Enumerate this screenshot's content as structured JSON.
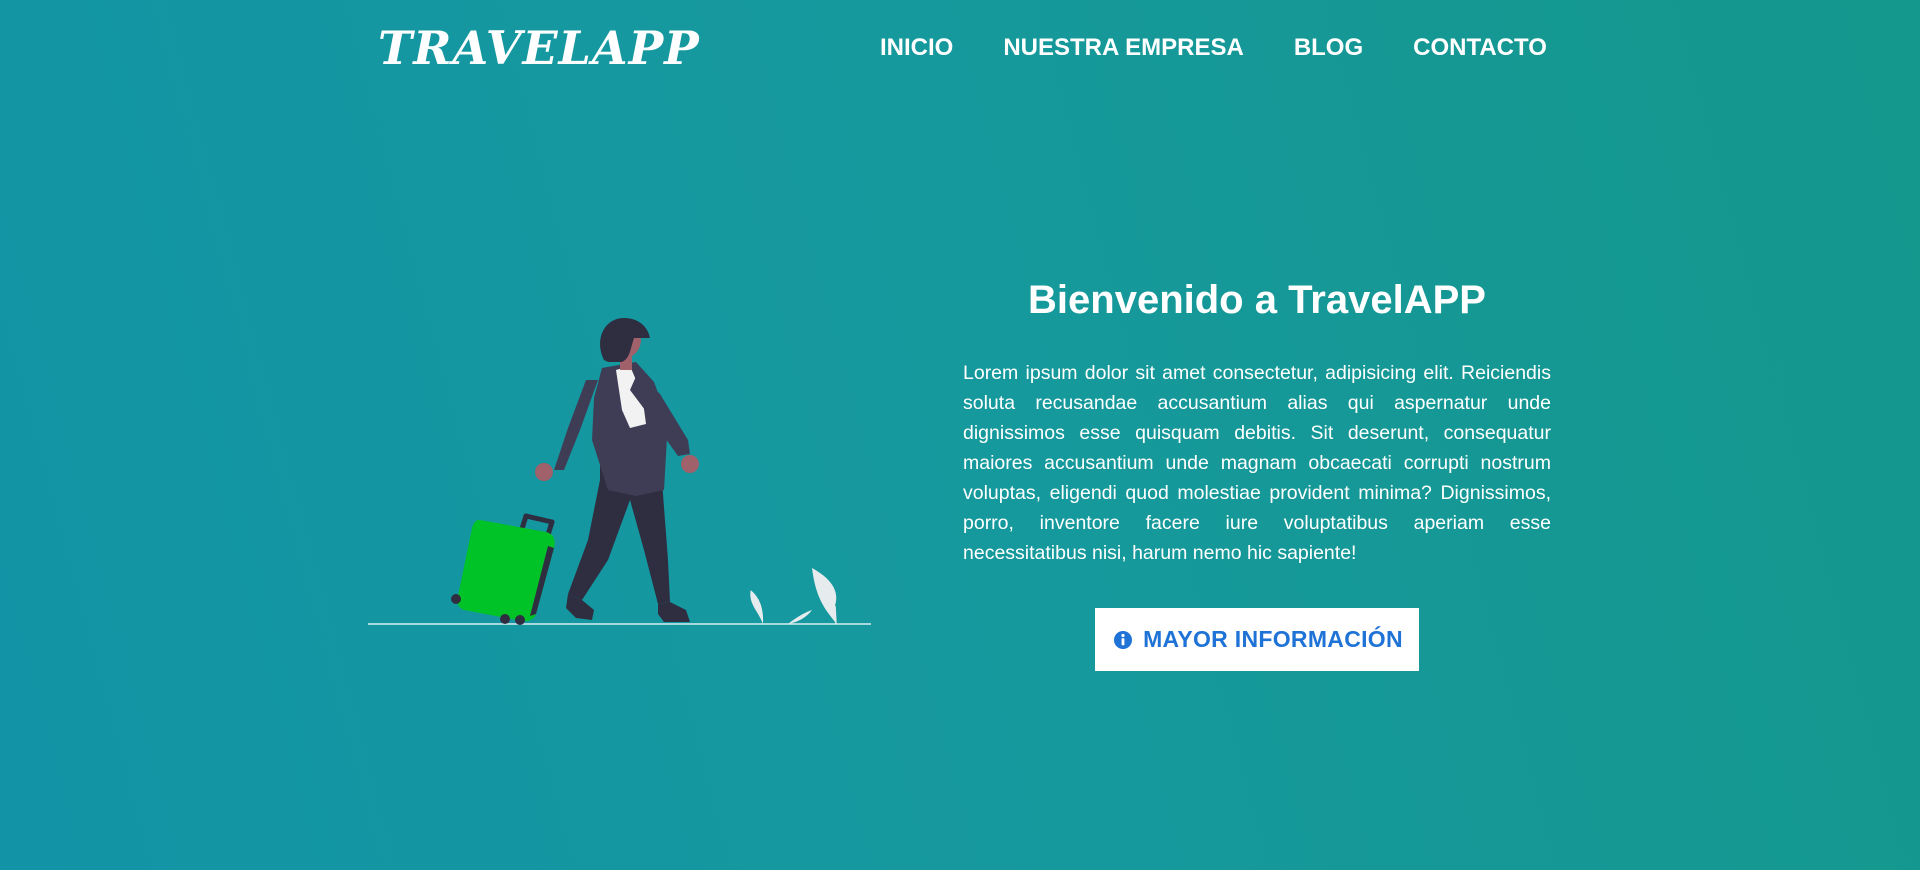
{
  "header": {
    "logo": "TRAVELAPP",
    "nav": [
      {
        "label": "INICIO"
      },
      {
        "label": "NUESTRA EMPRESA"
      },
      {
        "label": "BLOG"
      },
      {
        "label": "CONTACTO"
      }
    ]
  },
  "hero": {
    "title": "Bienvenido a TravelAPP",
    "body": "Lorem ipsum dolor sit amet consectetur, adipisicing elit. Reiciendis soluta recusandae accusantium alias qui aspernatur unde dignissimos esse quisquam debitis. Sit deserunt, consequatur maiores accusantium unde magnam obcaecati corrupti nostrum voluptas, eligendi quod molestiae provident minima? Dignissimos, porro, inventore facere iure voluptatibus aperiam esse necessitatibus nisi, harum nemo hic sapiente!",
    "cta_label": "MAYOR INFORMACIÓN",
    "cta_icon": "info-circle-icon"
  },
  "colors": {
    "background_start": "#1294a6",
    "background_end": "#14978c",
    "text": "#ffffff",
    "cta_text": "#1f72d6",
    "suitcase": "#00c427"
  }
}
